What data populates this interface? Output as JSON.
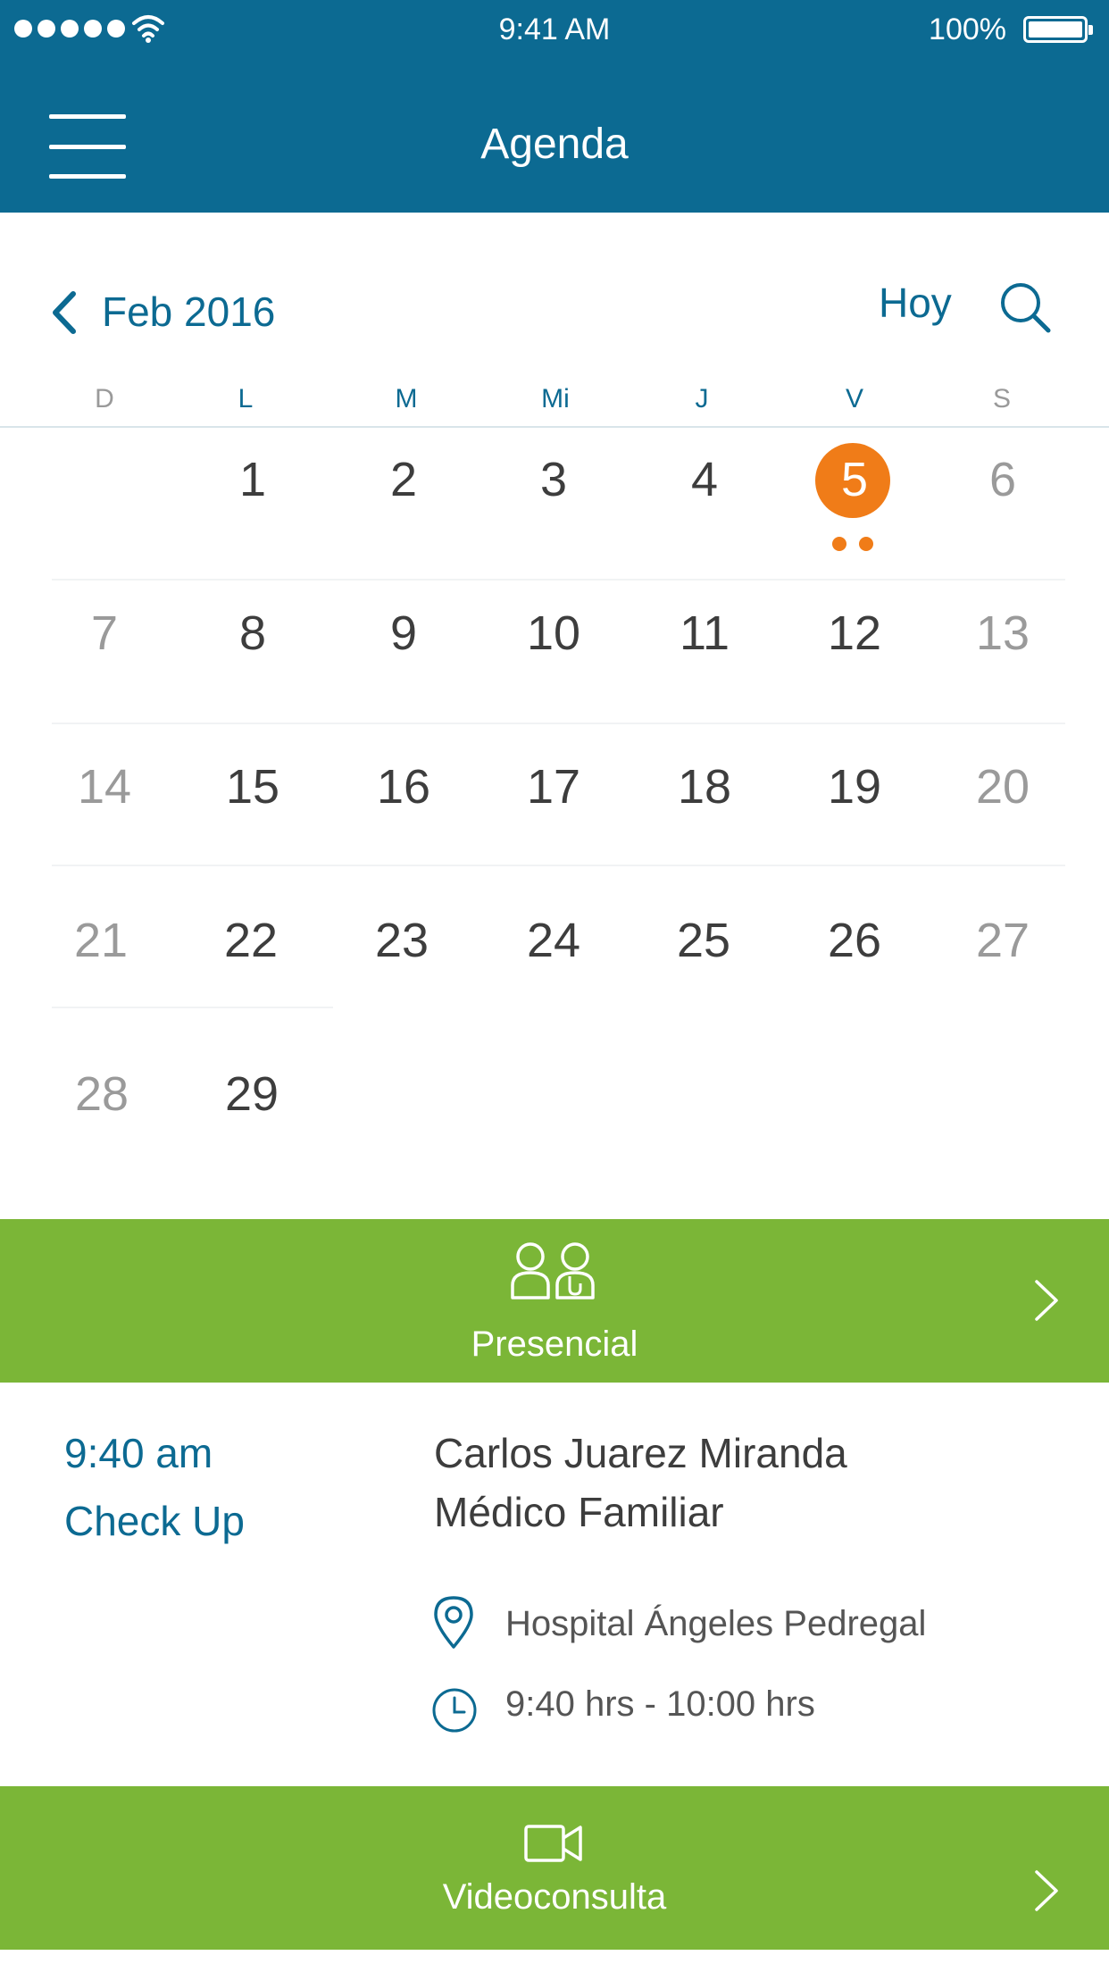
{
  "status_bar": {
    "time": "9:41 AM",
    "battery": "100%",
    "battery_level": 1.0
  },
  "header": {
    "title": "Agenda",
    "menu_icon": "hamburger-menu-icon"
  },
  "calendar": {
    "month_label": "Feb 2016",
    "today_label": "Hoy",
    "back_icon": "chevron-left-icon",
    "search_icon": "search-icon",
    "weekdays": [
      "D",
      "L",
      "M",
      "Mi",
      "J",
      "V",
      "S"
    ],
    "weeks": [
      [
        "",
        "1",
        "2",
        "3",
        "4",
        "5",
        "6"
      ],
      [
        "7",
        "8",
        "9",
        "10",
        "11",
        "12",
        "13"
      ],
      [
        "14",
        "15",
        "16",
        "17",
        "18",
        "19",
        "20"
      ],
      [
        "21",
        "22",
        "23",
        "24",
        "25",
        "26",
        "27"
      ],
      [
        "28",
        "29",
        "",
        "",
        "",
        "",
        ""
      ]
    ],
    "selected_day": "5",
    "selected_day_event_count": 2
  },
  "sections": [
    {
      "label": "Presencial",
      "icon": "people-icon"
    },
    {
      "label": "Videoconsulta",
      "icon": "video-camera-icon"
    }
  ],
  "appointment": {
    "time": "9:40 am",
    "type": "Check Up",
    "doctor": "Carlos Juarez Miranda",
    "specialty": "Médico Familiar",
    "location": "Hospital Ángeles Pedregal",
    "time_range": "9:40 hrs - 10:00 hrs"
  },
  "colors": {
    "header": "#0c6a92",
    "accent_green": "#7bb637",
    "today_orange": "#f07c18",
    "text_blue": "#0c6a92",
    "weekend_gray": "#9a9a9a"
  }
}
